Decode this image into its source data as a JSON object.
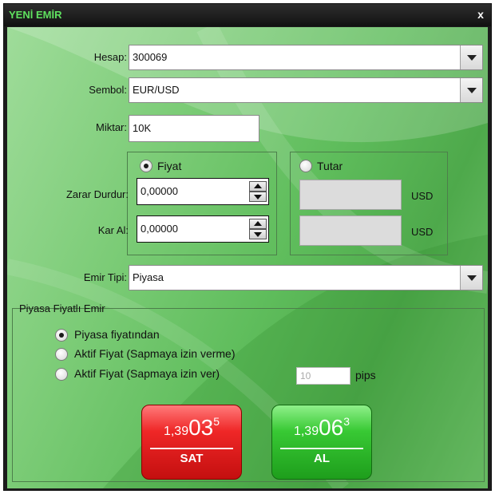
{
  "window": {
    "title": "YENİ EMİR",
    "close_label": "x"
  },
  "form": {
    "hesap": {
      "label": "Hesap:",
      "value": "300069"
    },
    "sembol": {
      "label": "Sembol:",
      "value": "EUR/USD"
    },
    "miktar": {
      "label": "Miktar:",
      "value": "10K"
    },
    "fiyat_option": {
      "label": "Fiyat",
      "selected": true
    },
    "tutar_option": {
      "label": "Tutar",
      "selected": false
    },
    "zarar_durdur": {
      "label": "Zarar Durdur:",
      "value": "0,00000",
      "currency": "USD"
    },
    "kar_al": {
      "label": "Kar Al:",
      "value": "0,00000",
      "currency": "USD"
    },
    "emir_tipi": {
      "label": "Emir Tipi:",
      "value": "Piyasa"
    }
  },
  "market_group": {
    "legend": "Piyasa Fiyatlı Emir",
    "options": [
      {
        "label": "Piyasa fiyatından",
        "selected": true
      },
      {
        "label": "Aktif Fiyat (Sapmaya izin verme)",
        "selected": false
      },
      {
        "label": "Aktif Fiyat (Sapmaya izin ver)",
        "selected": false
      }
    ],
    "pips_value": "10",
    "pips_unit": "pips"
  },
  "trade_buttons": {
    "sell": {
      "prefix": "1,39",
      "big": "03",
      "sup": "5",
      "label": "SAT"
    },
    "buy": {
      "prefix": "1,39",
      "big": "06",
      "sup": "3",
      "label": "AL"
    }
  },
  "colors": {
    "title_green": "#5fe15f",
    "sell_red": "#e11b1b",
    "buy_green": "#2fbd2c"
  }
}
